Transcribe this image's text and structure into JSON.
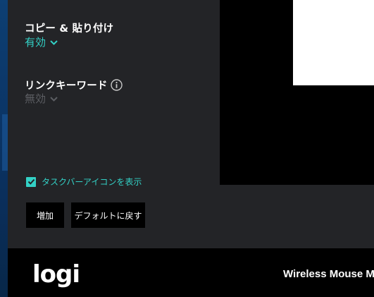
{
  "settings": {
    "copy_paste": {
      "label": "コピー & 貼り付け",
      "value": "有効"
    },
    "link_keyword": {
      "label": "リンクキーワード",
      "value": "無効"
    }
  },
  "options": {
    "taskbar_icon_label": "タスクバーアイコンを表示",
    "taskbar_icon_checked": true
  },
  "buttons": {
    "add": "増加",
    "reset": "デフォルトに戻す"
  },
  "footer": {
    "logo": "logi",
    "device_name": "Wireless Mouse M"
  },
  "colors": {
    "accent": "#33d1c6",
    "panel": "#232427",
    "footer": "#000000",
    "disabled": "#5c5e63"
  }
}
